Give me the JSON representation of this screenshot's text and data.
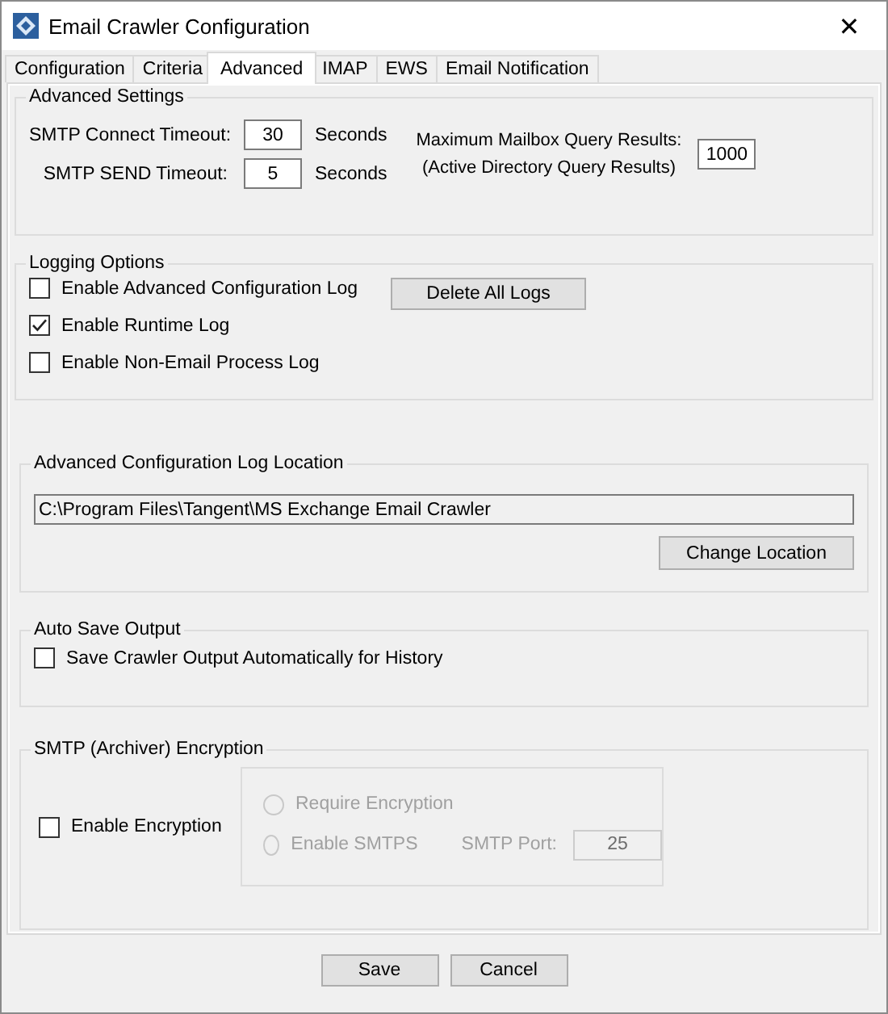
{
  "window": {
    "title": "Email Crawler Configuration",
    "close": "✕"
  },
  "tabs": [
    {
      "label": "Configuration",
      "selected": false
    },
    {
      "label": "Criteria",
      "selected": false
    },
    {
      "label": "Advanced",
      "selected": true
    },
    {
      "label": "IMAP",
      "selected": false
    },
    {
      "label": "EWS",
      "selected": false
    },
    {
      "label": "Email Notification",
      "selected": false
    }
  ],
  "advanced_settings": {
    "title": "Advanced Settings",
    "timeouts": [
      {
        "label": "SMTP Connect Timeout:",
        "value": "30",
        "unit": "Seconds"
      },
      {
        "label": "SMTP SEND Timeout:",
        "value": "5",
        "unit": "Seconds"
      }
    ],
    "max_results": {
      "label_lines": [
        "Maximum Mailbox Query Results:",
        "(Active Directory Query Results)"
      ],
      "value": "1000"
    }
  },
  "logging": {
    "title": "Logging Options",
    "options": [
      {
        "label": "Enable Advanced Configuration Log",
        "checked": false
      },
      {
        "label": "Enable Runtime Log",
        "checked": true
      },
      {
        "label": "Enable Non-Email Process Log",
        "checked": false
      }
    ],
    "button": "Delete All Logs"
  },
  "log_location": {
    "title": "Advanced Configuration Log Location",
    "path": "C:\\Program Files\\Tangent\\MS Exchange Email Crawler",
    "button": "Change Location"
  },
  "auto_save": {
    "title": "Auto Save Output",
    "option": {
      "label": "Save Crawler Output Automatically for History",
      "checked": false
    }
  },
  "encryption": {
    "title": "SMTP (Archiver) Encryption",
    "enable": {
      "label": "Enable Encryption",
      "checked": false
    },
    "options_disabled": true,
    "radios": [
      {
        "label": "Require Encryption",
        "selected": false
      },
      {
        "label": "Enable SMTPS",
        "selected": false
      }
    ],
    "port_label": "SMTP Port:",
    "port": "25"
  },
  "buttons": [
    "Save",
    "Cancel"
  ]
}
